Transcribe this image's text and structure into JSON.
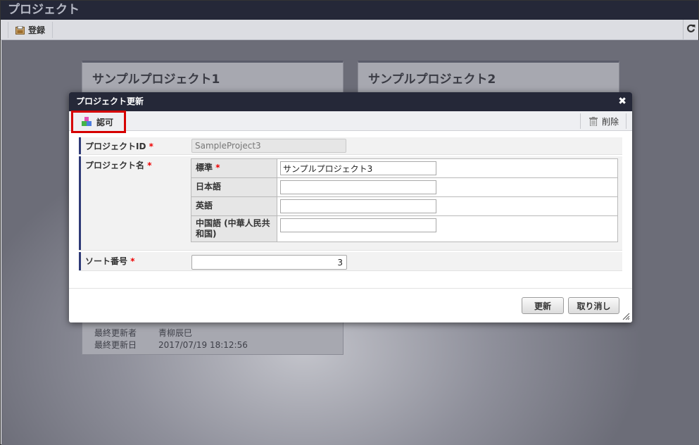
{
  "app": {
    "title": "プロジェクト"
  },
  "toolbar": {
    "register_label": "登録",
    "refresh_icon": "refresh-icon"
  },
  "cards": [
    {
      "title": "サンプルプロジェクト1",
      "last_updated_by_label": "最終更新者",
      "last_updated_by": "青柳辰巳",
      "last_updated_at_label": "最終更新日",
      "last_updated_at": "2017/07/19 18:12:56"
    },
    {
      "title": "サンプルプロジェクト2"
    }
  ],
  "dialog": {
    "title": "プロジェクト更新",
    "approve_label": "認可",
    "delete_label": "削除",
    "project_id_label": "プロジェクトID",
    "project_id_value": "SampleProject3",
    "project_name_label": "プロジェクト名",
    "names": [
      {
        "lang": "標準",
        "required": "*",
        "value": "サンプルプロジェクト3"
      },
      {
        "lang": "日本語",
        "value": ""
      },
      {
        "lang": "英語",
        "value": ""
      },
      {
        "lang": "中国語 (中華人民共和国)",
        "value": ""
      }
    ],
    "sort_label": "ソート番号",
    "sort_value": "3",
    "required_mark": "*",
    "update_label": "更新",
    "cancel_label": "取り消し"
  },
  "colors": {
    "header": "#252838",
    "accent_border": "#2e3a77",
    "highlight": "#d60000",
    "required": "#e00000"
  }
}
